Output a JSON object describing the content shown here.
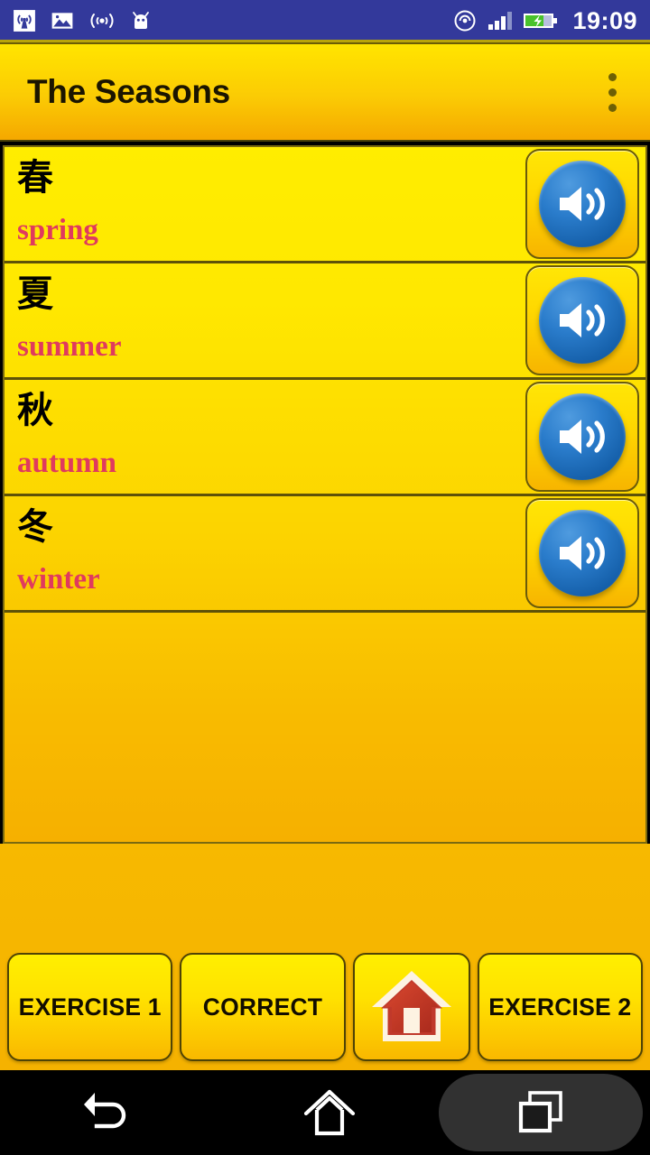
{
  "statusbar": {
    "time": "19:09",
    "left_icons": [
      "broadcast-tower-icon",
      "image-icon",
      "wifi-waves-icon",
      "android-robot-icon"
    ],
    "right_icons": [
      "hotspot-icon",
      "signal-bars-icon",
      "battery-charging-icon"
    ],
    "signal_bars": 3,
    "background_color": "#33399b"
  },
  "appbar": {
    "title": "The Seasons",
    "overflow_label": "More options",
    "accent_top": "#ffe400",
    "accent_bottom": "#f5a800"
  },
  "list": {
    "rows": [
      {
        "kanji": "春",
        "romaji": "spring",
        "speaker_label": "Play spring"
      },
      {
        "kanji": "夏",
        "romaji": "summer",
        "speaker_label": "Play summer"
      },
      {
        "kanji": "秋",
        "romaji": "autumn",
        "speaker_label": "Play autumn"
      },
      {
        "kanji": "冬",
        "romaji": "winter",
        "speaker_label": "Play winter"
      }
    ],
    "romaji_color": "#e03a5e",
    "kanji_color": "#000000"
  },
  "bottom_bar": {
    "buttons": [
      {
        "label": "EXERCISE 1",
        "icon": null
      },
      {
        "label": "CORRECT",
        "icon": null
      },
      {
        "label": "",
        "icon": "home-house-icon"
      },
      {
        "label": "EXERCISE 2",
        "icon": null
      }
    ]
  },
  "navbar": {
    "back_label": "Back",
    "home_label": "Home",
    "recents_label": "Recent apps"
  }
}
